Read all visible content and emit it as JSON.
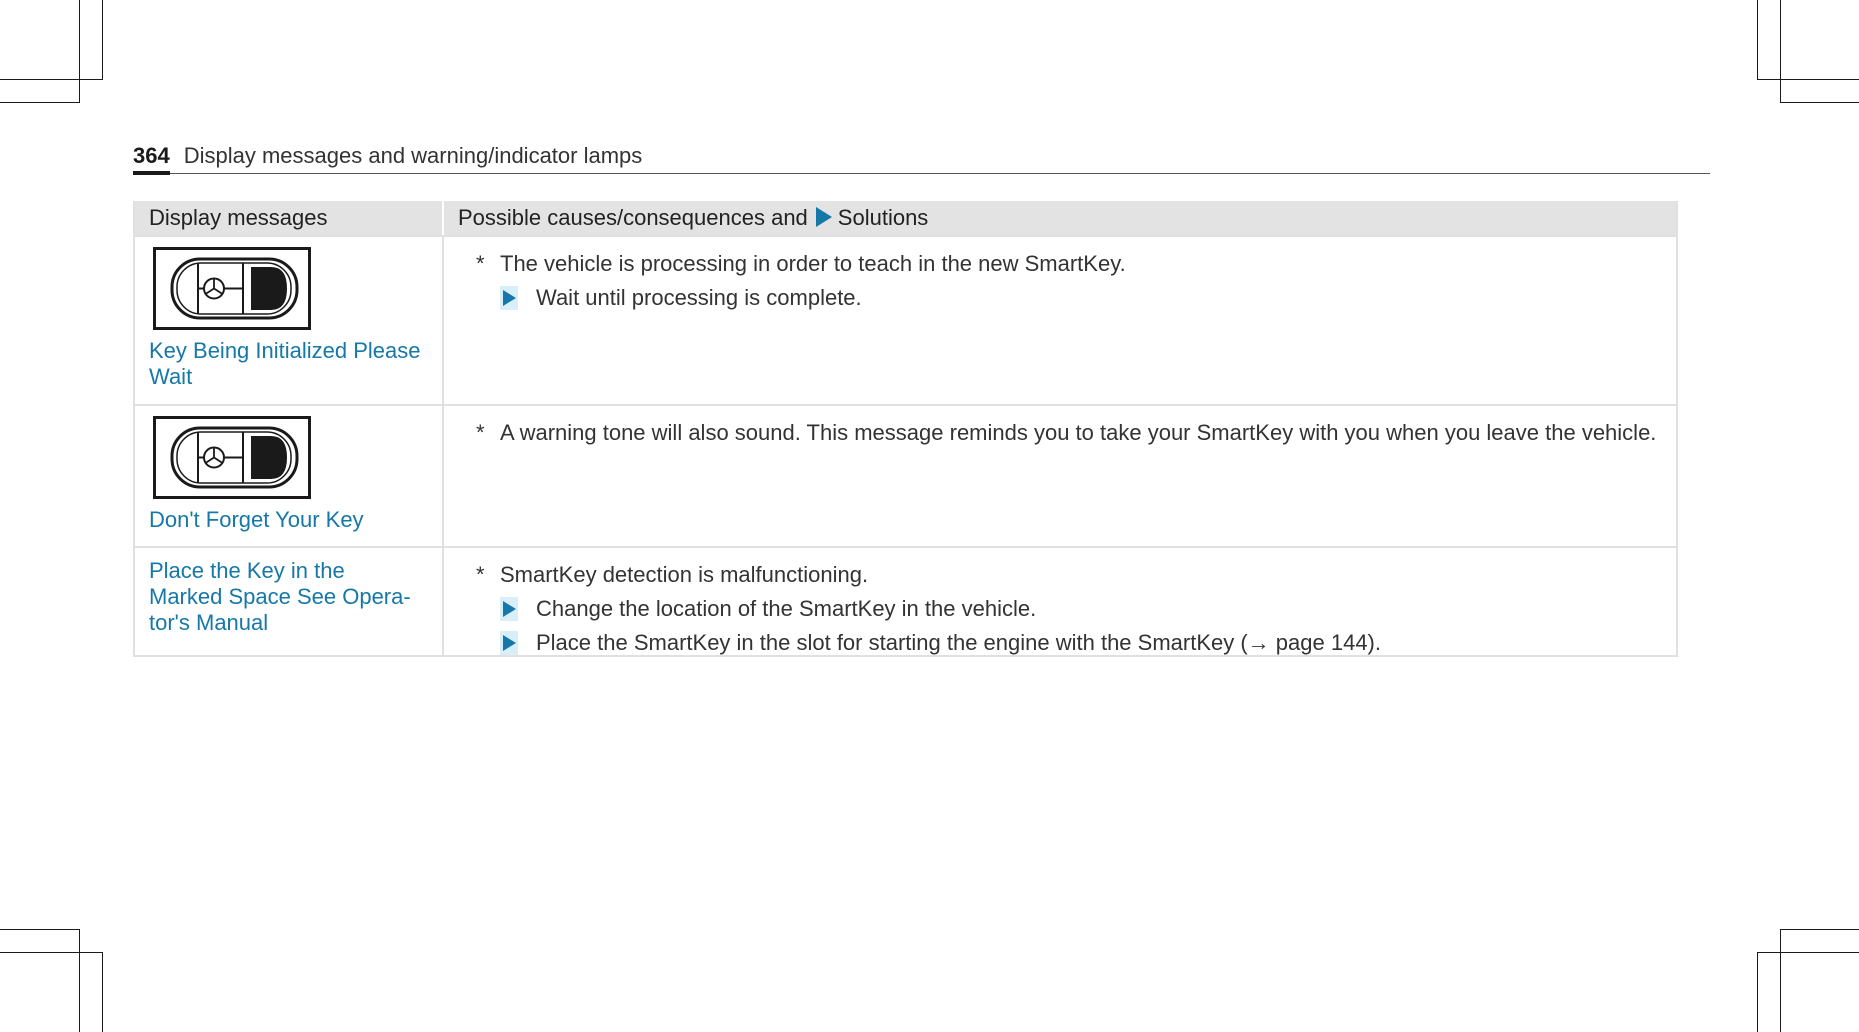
{
  "header": {
    "page_number": "364",
    "title": "Display messages and warning/indicator lamps"
  },
  "table": {
    "col1_header": "Display messages",
    "col2_header_prefix": "Possible causes/consequences and",
    "col2_header_suffix": "Solutions",
    "rows": [
      {
        "icon": "smartkey-icon",
        "message": "Key Being Initialized Please Wait",
        "cause": "The vehicle is processing in order to teach in the new SmartKey.",
        "steps": [
          "Wait until processing is complete."
        ]
      },
      {
        "icon": "smartkey-icon",
        "message": "Don't Forget Your Key",
        "cause": "A warning tone will also sound. This message reminds you to take your SmartKey with you when you leave the vehicle.",
        "steps": []
      },
      {
        "message_line1": "Place the Key in the",
        "message_line2": "Marked Space See Opera-",
        "message_line3": "tor's Manual",
        "cause": "SmartKey detection is malfunctioning.",
        "steps": [
          "Change the location of the SmartKey in the vehicle.",
          "Place the SmartKey in the slot for starting the engine with the SmartKey (→ page 144)."
        ]
      }
    ],
    "bullet": "*"
  },
  "colors": {
    "accent": "#1678a8",
    "header_bg": "#e3e3e3"
  }
}
